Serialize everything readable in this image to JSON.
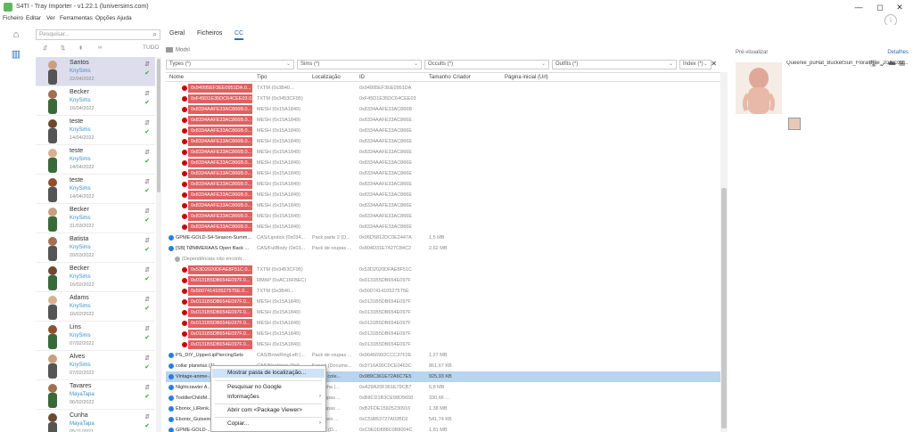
{
  "window": {
    "title": "S4TI - Tray Importer - v1.22.1 (luniversims.com)",
    "minimize": "—",
    "maximize": "◻",
    "close": "✕"
  },
  "menu": [
    "Ficheiro",
    "Editar",
    "Ver",
    "Ferramentas",
    "Opções",
    "Ajuda"
  ],
  "leftnav": [
    {
      "icon": "home-icon",
      "glyph": "⌂"
    },
    {
      "icon": "library-icon",
      "glyph": "▥"
    }
  ],
  "search": {
    "placeholder": "Pesquisar..."
  },
  "tray_filters": [
    "⇵",
    "⇅",
    "⇞",
    "∞",
    "TUDO"
  ],
  "tray_items": [
    {
      "name": "Santos",
      "creator": "KnySims",
      "date": "22/04/2022",
      "selected": true
    },
    {
      "name": "Becker",
      "creator": "KnySims",
      "date": "16/04/2022"
    },
    {
      "name": "teste",
      "creator": "KnySims",
      "date": "14/04/2022"
    },
    {
      "name": "teste",
      "creator": "KnySims",
      "date": "14/04/2022"
    },
    {
      "name": "teste",
      "creator": "KnySims",
      "date": "14/04/2022"
    },
    {
      "name": "Becker",
      "creator": "KnySims",
      "date": "31/03/2022"
    },
    {
      "name": "Batista",
      "creator": "KnySims",
      "date": "20/03/2022"
    },
    {
      "name": "Becker",
      "creator": "KnySims",
      "date": "16/02/2022"
    },
    {
      "name": "Adams",
      "creator": "KnySims",
      "date": "16/02/2022"
    },
    {
      "name": "Lins",
      "creator": "KnySims",
      "date": "07/02/2022"
    },
    {
      "name": "Alves",
      "creator": "KnySims",
      "date": "07/02/2022"
    },
    {
      "name": "Tavares",
      "creator": "MayaTapa",
      "date": "06/02/2022"
    },
    {
      "name": "Cunha",
      "creator": "MayaTapa",
      "date": "05/11/2021"
    }
  ],
  "tabs": [
    "Geral",
    "Ficheiros",
    "CC"
  ],
  "path": "Mods\\",
  "filters": {
    "types": "Types (*)",
    "sims": "Sims (*)",
    "occults": "Occults (*)",
    "outfits": "Outfits (*)",
    "index": "Index (*)"
  },
  "columns": [
    "Nome",
    "Tipo",
    "Localização",
    "ID",
    "Tamanho",
    "Criador",
    "Página inicial (Url)"
  ],
  "rows": [
    {
      "kind": "red",
      "name": "0x94995EF3EE0951DA.0...",
      "tipo": "TXTM (0x3B40...",
      "loc": "",
      "id": "0x94995EF3EE0951DA",
      "size": ""
    },
    {
      "kind": "red",
      "name": "0xF45D1E35DC64CEE03.0...",
      "tipo": "TXTM (0x3453CF95)",
      "loc": "",
      "id": "0xF45D1E35DC64CEE03",
      "size": ""
    },
    {
      "kind": "red",
      "name": "0x8334AAFE33AC866B.0...",
      "tipo": "MESH (0x15A1849)",
      "loc": "",
      "id": "0x8334AAFE33AC866B",
      "size": ""
    },
    {
      "kind": "red",
      "name": "0x8334AAFE33AC866B.0...",
      "tipo": "MESH (0x15A1849)",
      "loc": "",
      "id": "0x8334AAFE33AC866E",
      "size": ""
    },
    {
      "kind": "red",
      "name": "0x8334AAFE33AC866B.0...",
      "tipo": "MESH (0x15A1849)",
      "loc": "",
      "id": "0x8334AAFE33AC866E",
      "size": ""
    },
    {
      "kind": "red",
      "name": "0x8334AAFE33AC866B.0...",
      "tipo": "MESH (0x15A1849)",
      "loc": "",
      "id": "0x8334AAFE33AC866E",
      "size": ""
    },
    {
      "kind": "red",
      "name": "0x8334AAFE33AC866B.0...",
      "tipo": "MESH (0x15A1849)",
      "loc": "",
      "id": "0x8334AAFE33AC866E",
      "size": ""
    },
    {
      "kind": "red",
      "name": "0x8334AAFE33AC866B.0...",
      "tipo": "MESH (0x15A1849)",
      "loc": "",
      "id": "0x8334AAFE33AC866E",
      "size": ""
    },
    {
      "kind": "red",
      "name": "0x8334AAFE33AC866B.0...",
      "tipo": "MESH (0x15A1849)",
      "loc": "",
      "id": "0x8334AAFE33AC866E",
      "size": ""
    },
    {
      "kind": "red",
      "name": "0x8334AAFE33AC866B.0...",
      "tipo": "MESH (0x15A1849)",
      "loc": "",
      "id": "0x8334AAFE33AC866E",
      "size": ""
    },
    {
      "kind": "red",
      "name": "0x8334AAFE33AC866B.0...",
      "tipo": "MESH (0x15A1849)",
      "loc": "",
      "id": "0x8334AAFE33AC866E",
      "size": ""
    },
    {
      "kind": "red",
      "name": "0x8334AAFE33AC866B.0...",
      "tipo": "MESH (0x15A1849)",
      "loc": "",
      "id": "0x8334AAFE33AC866E",
      "size": ""
    },
    {
      "kind": "red",
      "name": "0x8334AAFE33AC866B.0...",
      "tipo": "MESH (0x15A1849)",
      "loc": "",
      "id": "0x8334AAFE33AC866E",
      "size": ""
    },
    {
      "kind": "red",
      "name": "0x8334AAFE33AC866B.0...",
      "tipo": "MESH (0x15A1849)",
      "loc": "",
      "id": "0x8334AAFE33AC866E",
      "size": ""
    },
    {
      "kind": "blue",
      "name": "GPME-GOLD-S4-Season-Summ...",
      "tipo": "CAS/Lipstick (0x034...",
      "loc": "Pack parte 2 (D...",
      "id": "0x06D5812DC0E2447A",
      "size": "1,5 MB"
    },
    {
      "kind": "blue",
      "name": "[SB] TØMMERAAS Open Back ...",
      "tipo": "CAS/FullBody (0x03...",
      "loc": "Pack de roupas ...",
      "id": "0x804D31E7427C84C2",
      "size": "2,62 MB"
    },
    {
      "kind": "gray",
      "name": "(Dependências não encontr...",
      "tipo": "",
      "loc": "",
      "id": "",
      "size": ""
    },
    {
      "kind": "red",
      "name": "0x53D2020DFAE8F51C.0...",
      "tipo": "TXTM (0x3453CF95)",
      "loc": "",
      "id": "0x53D2020DFAE8F51C",
      "size": ""
    },
    {
      "kind": "red",
      "name": "0x0131B5DB654E097F.0...",
      "tipo": "RMAP (0xAC16FBEC)",
      "loc": "",
      "id": "0x0131B5DB654E097F",
      "size": ""
    },
    {
      "kind": "red",
      "name": "0x5007414105275T5E.0...",
      "tipo": "TXTM (0x3B40...",
      "loc": "",
      "id": "0x5007414105275T5E",
      "size": ""
    },
    {
      "kind": "red",
      "name": "0x0131B5DB654E097F.0...",
      "tipo": "MESH (0x15A1849)",
      "loc": "",
      "id": "0x0131B5DB654E097F",
      "size": ""
    },
    {
      "kind": "red",
      "name": "0x0131B5DB654E097F.0...",
      "tipo": "MESH (0x15A1849)",
      "loc": "",
      "id": "0x0131B5DB654E097F",
      "size": ""
    },
    {
      "kind": "red",
      "name": "0x0131B5DB654E097F.0...",
      "tipo": "MESH (0x15A1849)",
      "loc": "",
      "id": "0x0131B5DB654E097F",
      "size": ""
    },
    {
      "kind": "red",
      "name": "0x0131B5DB654E097F.0...",
      "tipo": "MESH (0x15A1849)",
      "loc": "",
      "id": "0x0131B5DB654E097F",
      "size": ""
    },
    {
      "kind": "red",
      "name": "0x0131B5DB654E097F.0...",
      "tipo": "MESH (0x15A1849)",
      "loc": "",
      "id": "0x0131B5DB654E097F",
      "size": ""
    },
    {
      "kind": "blue",
      "name": "PS_DIY_UpperLipPiercingSets",
      "tipo": "CAS/BrowRingLeft (...",
      "loc": "Pack de roupas ...",
      "id": "0x96466992CCC37F2E",
      "size": "1,27 MB"
    },
    {
      "kind": "blue",
      "name": "collar planetas (1)",
      "tipo": "CAS/Necklace (0x0...",
      "loc": "Kawaii (Docume...",
      "id": "0x9716A90C0CE0463C",
      "size": "861,67 KB"
    },
    {
      "kind": "blue",
      "name": "Vintage-anime-...",
      "tipo": "...",
      "loc": "...CAS cole...",
      "id": "0x989C361E72A6C7E5",
      "size": "925,93 KB",
      "selected": true
    },
    {
      "kind": "blue",
      "name": "Nightcrawler A...",
      "tipo": "",
      "loc": "...e Alpha (...",
      "id": "0xA29A20F361E79CB7",
      "size": "6,8 MB"
    },
    {
      "kind": "blue",
      "name": "ToddlerChildM...",
      "tipo": "",
      "loc": "...e roupas ...",
      "id": "0xB8CD1B3CE98D5658",
      "size": "330,66 ..."
    },
    {
      "kind": "blue",
      "name": "Ebonix_LiRenk...",
      "tipo": "",
      "loc": "...e roupas ...",
      "id": "0xB2FDE15925230916",
      "size": "1,38 MB"
    },
    {
      "kind": "blue",
      "name": "Ebonix_Gutsein...",
      "tipo": "",
      "loc": "...Gutsein ...",
      "id": "0xC59853727A02BD2",
      "size": "541,74 KB"
    },
    {
      "kind": "blue",
      "name": "GPME-GOLD-...",
      "tipo": "",
      "loc": "...ste 2 (D...",
      "id": "0xC9E0D888C0B8004C",
      "size": "1,81 MB"
    }
  ],
  "context_menu": {
    "items": [
      {
        "label": "Mostrar pasta de localização...",
        "highlight": true
      },
      {
        "label": "Pesquisar no Google"
      },
      {
        "label": "Informações",
        "submenu": true
      },
      {
        "label": "Abrir com <Package Viewer>"
      },
      {
        "label": "Copiar...",
        "submenu": true
      }
    ]
  },
  "preview": {
    "label": "Pré-visualizar",
    "details": "Detalhes",
    "name": "Queenie_puHat_BucketSun_FloralBlue_2018032..."
  },
  "colors": {
    "accent": "#2a6db8",
    "red_row": "#e06060",
    "blue_dot": "#2a7de0",
    "selected_row": "#b8d4ee"
  }
}
